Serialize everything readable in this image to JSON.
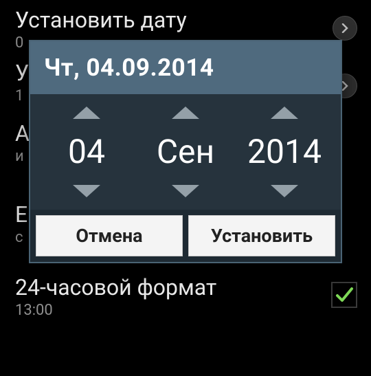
{
  "background": {
    "items": [
      {
        "title": "Установить дату",
        "sub": "0"
      },
      {
        "title": "У",
        "sub": "1"
      },
      {
        "title": "А",
        "sub": "и"
      },
      {
        "title": "Е",
        "sub": "с"
      },
      {
        "title": "24-часовой формат",
        "sub": "13:00"
      }
    ]
  },
  "dialog": {
    "header": "Чт, 04.09.2014",
    "day": "04",
    "month": "Сен",
    "year": "2014",
    "cancel": "Отмена",
    "ok": "Установить"
  },
  "colors": {
    "dialog_header": "#4f6a7e",
    "dialog_body": "#26333d",
    "accent_check": "#7ed957"
  }
}
